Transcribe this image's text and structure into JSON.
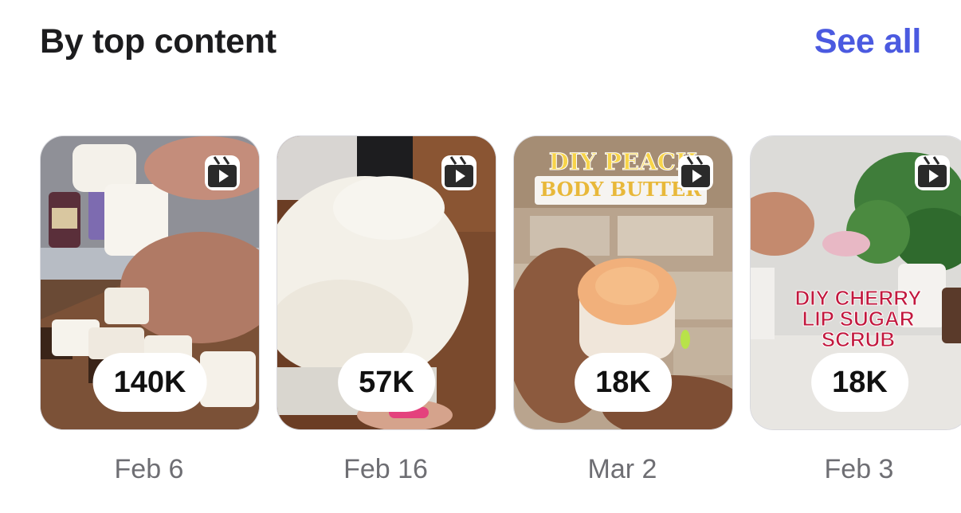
{
  "section": {
    "title": "By top content",
    "see_all_label": "See all"
  },
  "items": [
    {
      "count": "140K",
      "date": "Feb 6",
      "icon": "reel-icon"
    },
    {
      "count": "57K",
      "date": "Feb 16",
      "icon": "reel-icon"
    },
    {
      "count": "18K",
      "date": "Mar 2",
      "icon": "reel-icon",
      "overlay_line1": "DIY PEACH",
      "overlay_line2": "BODY BUTTER"
    },
    {
      "count": "18K",
      "date": "Feb 3",
      "icon": "reel-icon",
      "overlay_line1": "DIY CHERRY",
      "overlay_line2": "LIP SUGAR",
      "overlay_line3": "SCRUB"
    }
  ],
  "colors": {
    "accent": "#4b5ae0",
    "title": "#1c1c1e",
    "date": "#6e6e73"
  }
}
